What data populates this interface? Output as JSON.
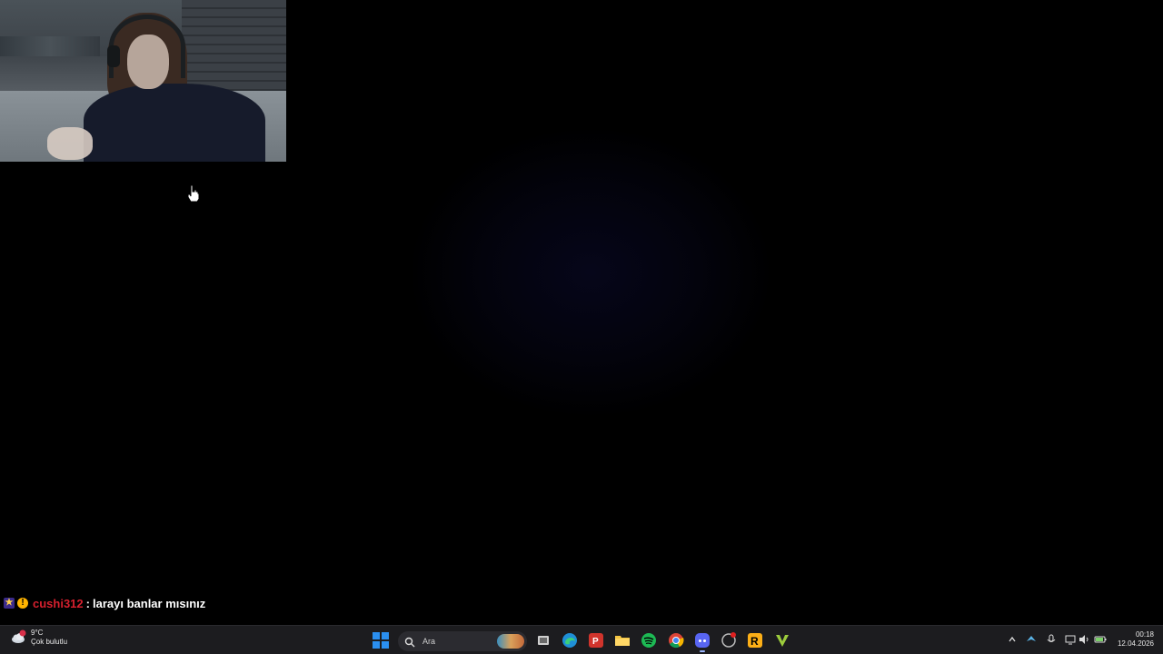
{
  "chat": {
    "username": "cushi312",
    "separator": ":",
    "message": "larayı banlar mısınız",
    "badges": [
      "moderator-star-icon",
      "alert-icon"
    ]
  },
  "taskbar": {
    "weather": {
      "temperature": "9°C",
      "condition": "Çok bulutlu",
      "alert_badge": "1"
    },
    "search": {
      "placeholder": "Ara"
    },
    "apps": [
      "start-icon",
      "search-icon",
      "task-view-icon",
      "edge-icon",
      "powerpoint-style-icon",
      "file-explorer-icon",
      "spotify-icon",
      "chrome-icon",
      "discord-icon",
      "steam-update-icon",
      "rockstar-icon",
      "vantage-icon"
    ],
    "tray": [
      "chevron-up-icon",
      "steam-tray-icon",
      "microphone-icon",
      "network-icon",
      "speaker-icon",
      "battery-icon"
    ],
    "clock": {
      "time": "00:18",
      "date": "12.04.2026"
    }
  },
  "colors": {
    "taskbar_bg": "#1c1c1f",
    "chat_username": "#d6202e",
    "windows_blue": "#2a8ff0"
  }
}
